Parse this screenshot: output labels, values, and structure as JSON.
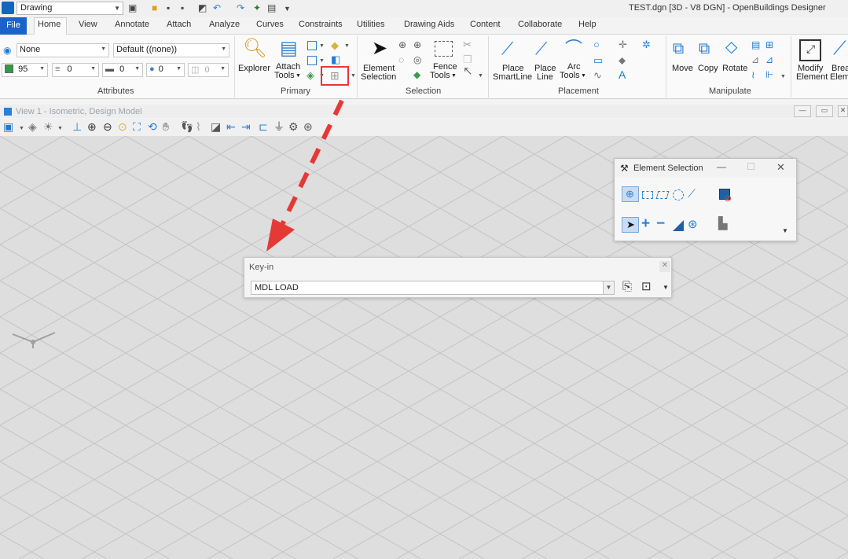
{
  "window": {
    "title": "TEST.dgn [3D - V8 DGN] - OpenBuildings Designer"
  },
  "workflow": {
    "value": "Drawing"
  },
  "tabs": [
    "File",
    "Home",
    "View",
    "Annotate",
    "Attach",
    "Analyze",
    "Curves",
    "Constraints",
    "Utilities",
    "Drawing Aids",
    "Content",
    "Collaborate",
    "Help"
  ],
  "attributes": {
    "level": "None",
    "style": "Default ((none))",
    "color": "95",
    "weight": "0",
    "linestyle": "0",
    "transparency": "0",
    "priority": "0",
    "label": "Attributes"
  },
  "primary": {
    "explorer": "Explorer",
    "attach_tools_1": "Attach",
    "attach_tools_2": "Tools",
    "label": "Primary"
  },
  "selection": {
    "element_selection_1": "Element",
    "element_selection_2": "Selection",
    "fence_tools_1": "Fence",
    "fence_tools_2": "Tools",
    "label": "Selection"
  },
  "placement": {
    "place_smartline_1": "Place",
    "place_smartline_2": "SmartLine",
    "place_line_1": "Place",
    "place_line_2": "Line",
    "arc_tools_1": "Arc",
    "arc_tools_2": "Tools",
    "label": "Placement"
  },
  "manipulate": {
    "move": "Move",
    "copy": "Copy",
    "rotate": "Rotate",
    "label": "Manipulate"
  },
  "modify": {
    "modify_element_1": "Modify",
    "modify_element_2": "Element",
    "break_1": "Brea",
    "break_2": "Eleme"
  },
  "view": {
    "title": "View 1 - Isometric, Design Model"
  },
  "element_selection_panel": {
    "title": "Element Selection"
  },
  "keyin_panel": {
    "title": "Key-in",
    "value": "MDL LOAD"
  },
  "colors": {
    "accent": "#1c63c9",
    "highlight": "#e53935",
    "grid": "#c8c8c8",
    "canvas": "#dedede"
  }
}
